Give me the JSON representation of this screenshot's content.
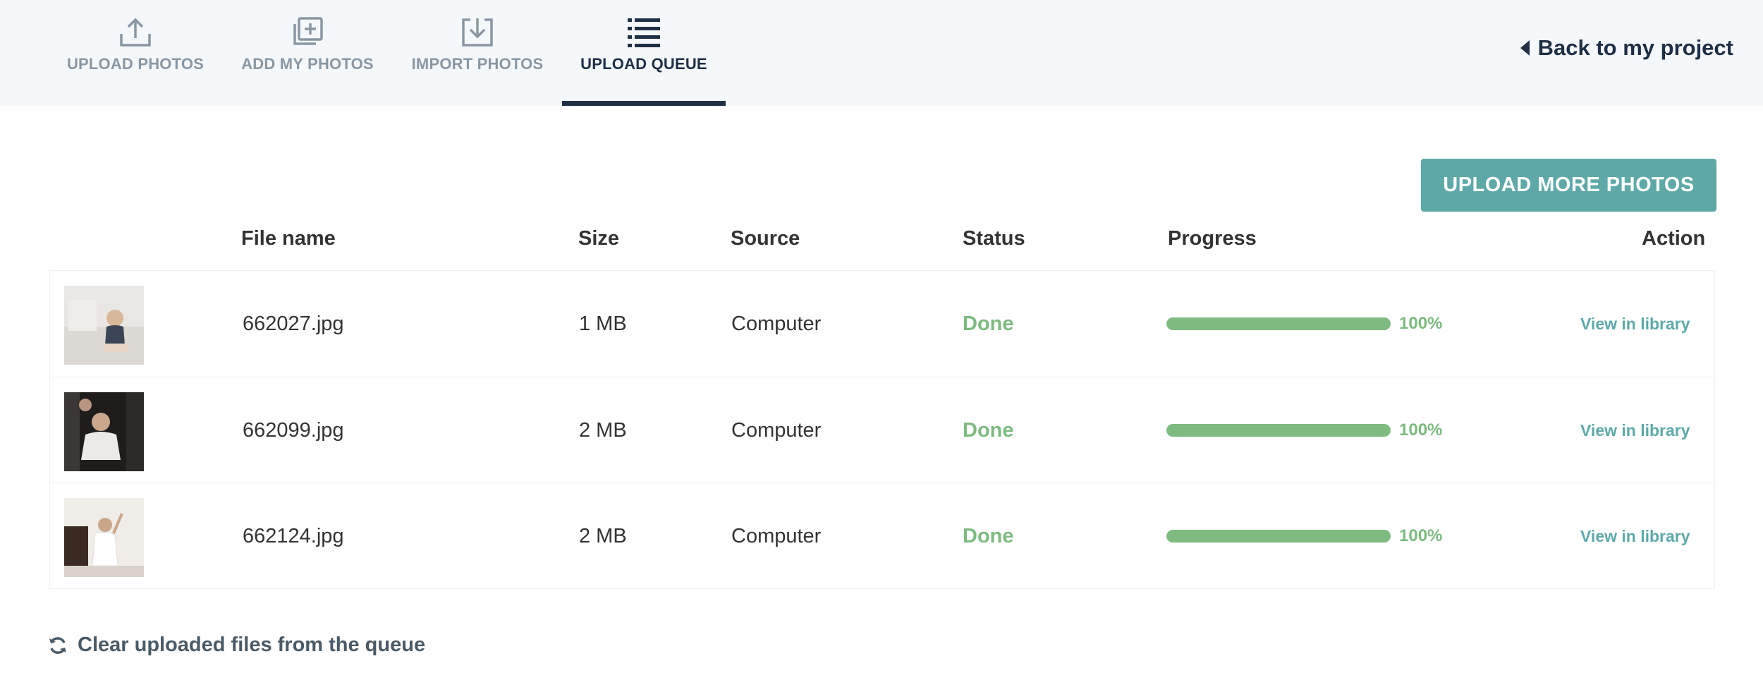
{
  "tabs": [
    {
      "label": "UPLOAD PHOTOS",
      "icon": "upload-icon",
      "active": false
    },
    {
      "label": "ADD MY PHOTOS",
      "icon": "add-photos-icon",
      "active": false
    },
    {
      "label": "IMPORT PHOTOS",
      "icon": "import-icon",
      "active": false
    },
    {
      "label": "UPLOAD QUEUE",
      "icon": "list-icon",
      "active": true
    }
  ],
  "header": {
    "back_label": "Back to my project"
  },
  "toolbar": {
    "upload_more_label": "UPLOAD MORE PHOTOS"
  },
  "table": {
    "columns": {
      "file_name": "File name",
      "size": "Size",
      "source": "Source",
      "status": "Status",
      "progress": "Progress",
      "action": "Action"
    },
    "rows": [
      {
        "file": "662027.jpg",
        "size": "1 MB",
        "source": "Computer",
        "status": "Done",
        "progress": 100,
        "progress_label": "100%",
        "action": "View in library"
      },
      {
        "file": "662099.jpg",
        "size": "2 MB",
        "source": "Computer",
        "status": "Done",
        "progress": 100,
        "progress_label": "100%",
        "action": "View in library"
      },
      {
        "file": "662124.jpg",
        "size": "2 MB",
        "source": "Computer",
        "status": "Done",
        "progress": 100,
        "progress_label": "100%",
        "action": "View in library"
      }
    ]
  },
  "footer": {
    "clear_label": "Clear uploaded files from the queue",
    "clear_icon": "refresh-icon"
  },
  "colors": {
    "accent": "#5ea9a8",
    "done": "#7dbb80",
    "dark": "#1f2f45"
  }
}
